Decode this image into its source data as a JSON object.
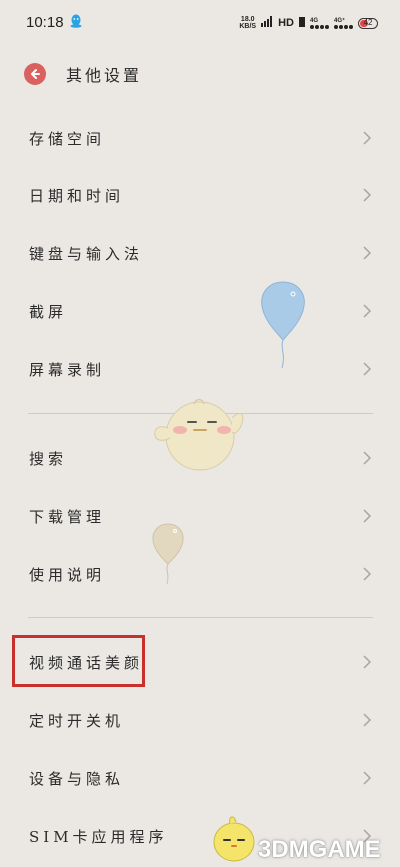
{
  "status_bar": {
    "time": "10:18",
    "speed_value": "18.0",
    "speed_unit": "KB/S",
    "hd": "HD",
    "net1": "4G",
    "net2": "4G⁺",
    "battery": "42",
    "qq_icon": "qq-penguin-icon"
  },
  "header": {
    "back_icon": "back-arrow-icon",
    "title": "其他设置"
  },
  "items": [
    {
      "label": "存储空间"
    },
    {
      "label": "日期和时间"
    },
    {
      "label": "键盘与输入法"
    },
    {
      "label": "截屏"
    },
    {
      "label": "屏幕录制"
    },
    {
      "label": "搜索"
    },
    {
      "label": "下载管理"
    },
    {
      "label": "使用说明"
    },
    {
      "label": "视频通话美颜"
    },
    {
      "label": "定时开关机"
    },
    {
      "label": "设备与隐私"
    },
    {
      "label": "SIM卡应用程序"
    }
  ],
  "highlighted_item": "视频通话美颜",
  "colors": {
    "background": "#ebe8e4",
    "back_button": "#d9615f",
    "highlight_border": "#c9302c",
    "balloon_blue": "#a9cbe8",
    "balloon_beige": "#e2d8bf"
  },
  "watermark": {
    "logo_text": "3DMGAME"
  }
}
